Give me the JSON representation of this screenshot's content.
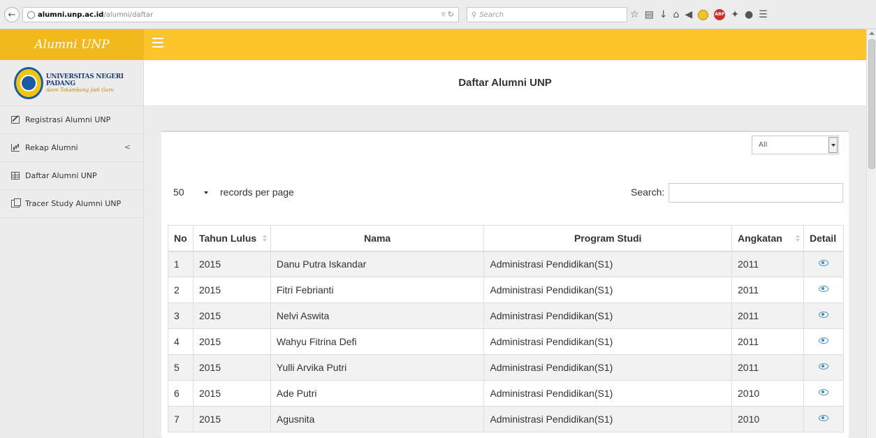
{
  "browser": {
    "url_domain": "alumni.unp.ac.id",
    "url_path": "/alumni/daftar",
    "search_placeholder": "Search"
  },
  "header": {
    "app_title": "Alumni UNP"
  },
  "sidebar": {
    "brand_name": "UNIVERSITAS NEGERI PADANG",
    "brand_motto": "Alam Takambang Jadi Guru",
    "items": [
      {
        "label": "Registrasi Alumni UNP",
        "icon": "edit-icon"
      },
      {
        "label": "Rekap Alumni",
        "icon": "bar-chart-icon",
        "chevron": "<"
      },
      {
        "label": "Daftar Alumni UNP",
        "icon": "table-icon"
      },
      {
        "label": "Tracer Study Alumni UNP",
        "icon": "copy-icon"
      }
    ]
  },
  "main": {
    "title": "Daftar Alumni UNP",
    "filter": {
      "selected": "All"
    },
    "length": {
      "value": "50",
      "label": "records per page"
    },
    "search": {
      "label": "Search:",
      "value": ""
    },
    "table": {
      "columns": [
        "No",
        "Tahun Lulus",
        "Nama",
        "Program Studi",
        "Angkatan",
        "Detail"
      ],
      "rows": [
        {
          "no": "1",
          "tahun": "2015",
          "nama": "Danu Putra Iskandar",
          "prodi": "Administrasi Pendidikan(S1)",
          "angkatan": "2011"
        },
        {
          "no": "2",
          "tahun": "2015",
          "nama": "Fitri Febrianti",
          "prodi": "Administrasi Pendidikan(S1)",
          "angkatan": "2011"
        },
        {
          "no": "3",
          "tahun": "2015",
          "nama": "Nelvi Aswita",
          "prodi": "Administrasi Pendidikan(S1)",
          "angkatan": "2011"
        },
        {
          "no": "4",
          "tahun": "2015",
          "nama": "Wahyu Fitrina Defi",
          "prodi": "Administrasi Pendidikan(S1)",
          "angkatan": "2011"
        },
        {
          "no": "5",
          "tahun": "2015",
          "nama": "Yulli Arvika Putri",
          "prodi": "Administrasi Pendidikan(S1)",
          "angkatan": "2011"
        },
        {
          "no": "6",
          "tahun": "2015",
          "nama": "Ade Putri",
          "prodi": "Administrasi Pendidikan(S1)",
          "angkatan": "2010"
        },
        {
          "no": "7",
          "tahun": "2015",
          "nama": "Agusnita",
          "prodi": "Administrasi Pendidikan(S1)",
          "angkatan": "2010"
        }
      ]
    }
  },
  "colors": {
    "header": "#fbc52b",
    "sidebar": "#ececec",
    "eye_icon": "#3c8dbc"
  }
}
